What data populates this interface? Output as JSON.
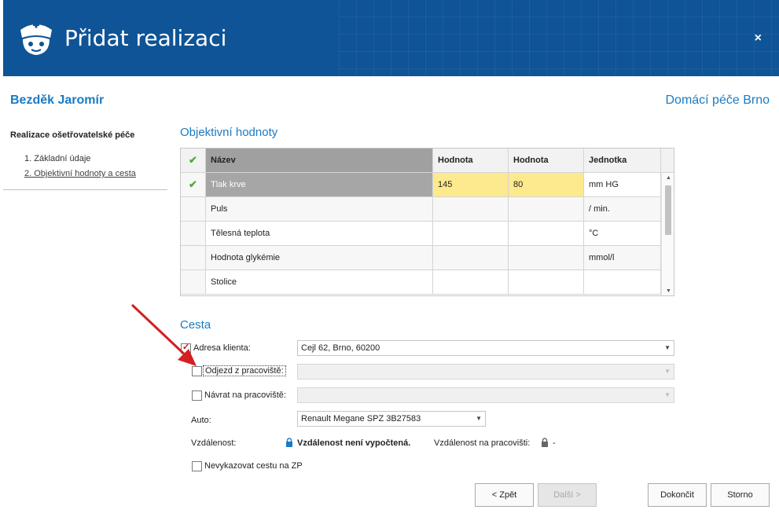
{
  "header": {
    "title": "Přidat realizaci",
    "close_label": "×"
  },
  "patient": {
    "name": "Bezděk Jaromír"
  },
  "organization": {
    "name": "Domácí péče Brno"
  },
  "nav": {
    "title": "Realizace ošetřovatelské péče",
    "steps": [
      {
        "label": "1. Základní údaje"
      },
      {
        "label": "2. Objektivní hodnoty a cesta"
      }
    ]
  },
  "objective": {
    "title": "Objektivní hodnoty",
    "columns": {
      "check": "✔",
      "name": "Název",
      "value1": "Hodnota",
      "value2": "Hodnota",
      "unit": "Jednotka"
    },
    "rows": [
      {
        "check": "✔",
        "name": "Tlak krve",
        "value1": "145",
        "value2": "80",
        "unit": "mm HG"
      },
      {
        "check": "",
        "name": "Puls",
        "value1": "",
        "value2": "",
        "unit": "/ min."
      },
      {
        "check": "",
        "name": "Tělesná teplota",
        "value1": "",
        "value2": "",
        "unit": "°C"
      },
      {
        "check": "",
        "name": "Hodnota glykémie",
        "value1": "",
        "value2": "",
        "unit": "mmol/l"
      },
      {
        "check": "",
        "name": "Stolice",
        "value1": "",
        "value2": "",
        "unit": ""
      }
    ]
  },
  "cesta": {
    "title": "Cesta",
    "client_address": {
      "label": "Adresa klienta:",
      "checked": true,
      "value": "Cejl 62, Brno, 60200"
    },
    "departure": {
      "label": "Odjezd z pracoviště:",
      "checked": false,
      "value": ""
    },
    "return": {
      "label": "Návrat na pracoviště:",
      "checked": false,
      "value": ""
    },
    "car": {
      "label": "Auto:",
      "value": "Renault Megane SPZ 3B27583"
    },
    "distance": {
      "label": "Vzdálenost:",
      "status": "Vzdálenost není vypočtená.",
      "workplace_label": "Vzdálenost na pracovišti:",
      "workplace_value": "-"
    },
    "no_report": {
      "label": "Nevykazovat cestu na ZP",
      "checked": false
    }
  },
  "buttons": {
    "back": "< Zpět",
    "next": "Další >",
    "finish": "Dokončit",
    "cancel": "Storno"
  },
  "colors": {
    "header_bg": "#0e5496",
    "accent": "#1a7bc4",
    "highlight": "#fde98e",
    "check": "#57a83a",
    "arrow": "#d42020"
  }
}
